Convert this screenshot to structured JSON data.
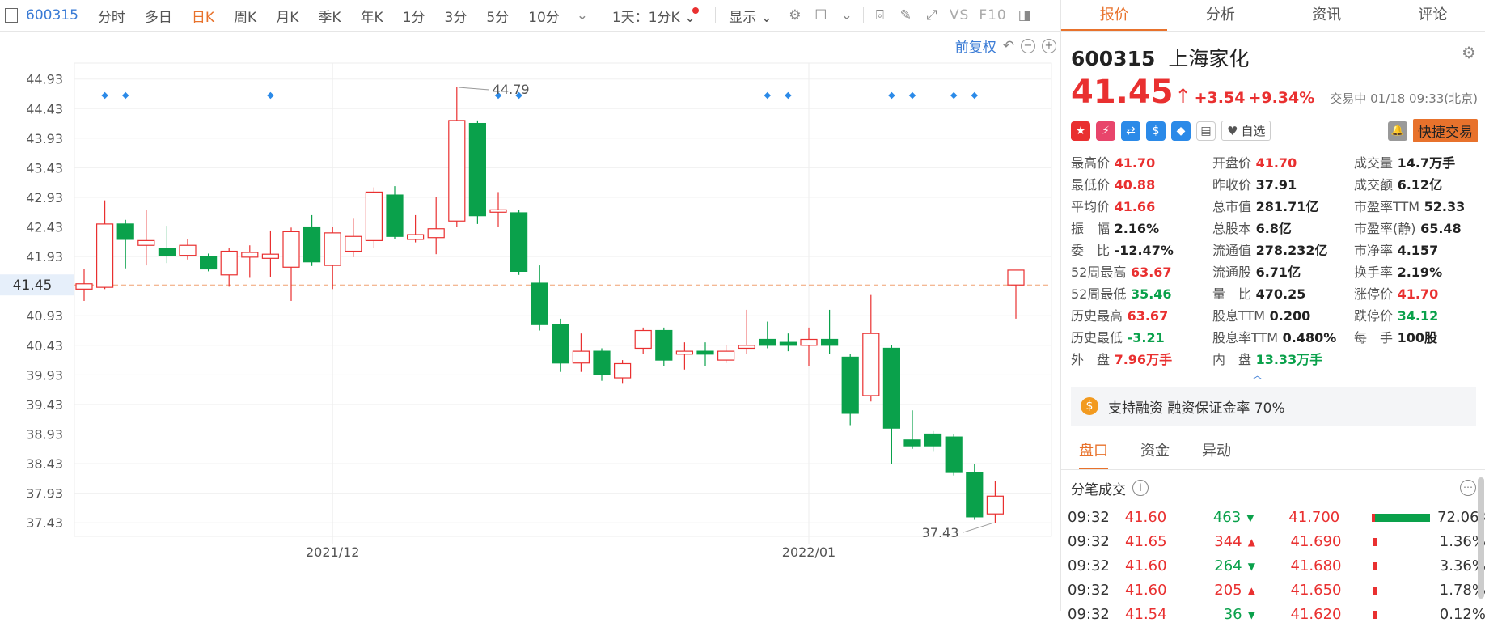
{
  "toolbar": {
    "code": "600315",
    "items": [
      "分时",
      "多日",
      "日K",
      "周K",
      "月K",
      "季K",
      "年K",
      "1分",
      "3分",
      "5分",
      "10分"
    ],
    "active": "日K",
    "period": "1天：1分K",
    "display": "显示",
    "vs": "VS",
    "f10": "F10"
  },
  "chart": {
    "fuquan": "前复权",
    "current_label": "41.45",
    "high_label": "44.79",
    "low_label": "37.43",
    "x_labels": [
      "2021/12",
      "2022/01"
    ]
  },
  "chart_data": {
    "type": "candlestick",
    "y_ticks": [
      "44.93",
      "44.43",
      "43.93",
      "43.43",
      "42.93",
      "42.43",
      "41.93",
      "41.45",
      "40.93",
      "40.43",
      "39.93",
      "39.43",
      "38.93",
      "38.43",
      "37.93",
      "37.43"
    ],
    "ylim": [
      37.2,
      45.2
    ],
    "current_price": 41.45,
    "candles": [
      {
        "o": 41.38,
        "c": 41.47,
        "h": 41.72,
        "l": 41.18
      },
      {
        "o": 41.41,
        "c": 42.48,
        "h": 42.88,
        "l": 41.38
      },
      {
        "o": 42.48,
        "c": 42.22,
        "h": 42.55,
        "l": 41.73
      },
      {
        "o": 42.12,
        "c": 42.2,
        "h": 42.72,
        "l": 41.78
      },
      {
        "o": 42.07,
        "c": 41.95,
        "h": 42.45,
        "l": 41.82
      },
      {
        "o": 41.95,
        "c": 42.12,
        "h": 42.23,
        "l": 41.88
      },
      {
        "o": 41.93,
        "c": 41.72,
        "h": 41.98,
        "l": 41.68
      },
      {
        "o": 41.62,
        "c": 42.02,
        "h": 42.07,
        "l": 41.42
      },
      {
        "o": 41.92,
        "c": 42.0,
        "h": 42.12,
        "l": 41.57
      },
      {
        "o": 41.9,
        "c": 41.97,
        "h": 42.37,
        "l": 41.59
      },
      {
        "o": 41.75,
        "c": 42.35,
        "h": 42.42,
        "l": 41.18
      },
      {
        "o": 42.43,
        "c": 41.84,
        "h": 42.63,
        "l": 41.77
      },
      {
        "o": 41.78,
        "c": 42.33,
        "h": 42.43,
        "l": 41.38
      },
      {
        "o": 42.02,
        "c": 42.27,
        "h": 42.57,
        "l": 41.92
      },
      {
        "o": 42.2,
        "c": 43.02,
        "h": 43.1,
        "l": 42.07
      },
      {
        "o": 42.97,
        "c": 42.27,
        "h": 43.12,
        "l": 42.22
      },
      {
        "o": 42.22,
        "c": 42.3,
        "h": 42.63,
        "l": 42.17
      },
      {
        "o": 42.25,
        "c": 42.4,
        "h": 42.93,
        "l": 41.97
      },
      {
        "o": 42.53,
        "c": 44.23,
        "h": 44.79,
        "l": 42.43
      },
      {
        "o": 44.18,
        "c": 42.62,
        "h": 44.23,
        "l": 42.48
      },
      {
        "o": 42.68,
        "c": 42.72,
        "h": 43.02,
        "l": 42.43
      },
      {
        "o": 42.67,
        "c": 41.68,
        "h": 42.72,
        "l": 41.62
      },
      {
        "o": 41.48,
        "c": 40.78,
        "h": 41.78,
        "l": 40.68
      },
      {
        "o": 40.78,
        "c": 40.13,
        "h": 40.88,
        "l": 39.98
      },
      {
        "o": 40.13,
        "c": 40.33,
        "h": 40.63,
        "l": 39.98
      },
      {
        "o": 40.33,
        "c": 39.93,
        "h": 40.38,
        "l": 39.83
      },
      {
        "o": 39.88,
        "c": 40.12,
        "h": 40.18,
        "l": 39.78
      },
      {
        "o": 40.38,
        "c": 40.68,
        "h": 40.73,
        "l": 40.28
      },
      {
        "o": 40.68,
        "c": 40.18,
        "h": 40.73,
        "l": 40.08
      },
      {
        "o": 40.28,
        "c": 40.33,
        "h": 40.48,
        "l": 40.02
      },
      {
        "o": 40.33,
        "c": 40.28,
        "h": 40.48,
        "l": 40.08
      },
      {
        "o": 40.18,
        "c": 40.33,
        "h": 40.43,
        "l": 40.13
      },
      {
        "o": 40.38,
        "c": 40.43,
        "h": 41.03,
        "l": 40.28
      },
      {
        "o": 40.53,
        "c": 40.43,
        "h": 40.83,
        "l": 40.38
      },
      {
        "o": 40.48,
        "c": 40.43,
        "h": 40.63,
        "l": 40.33
      },
      {
        "o": 40.43,
        "c": 40.53,
        "h": 40.73,
        "l": 40.08
      },
      {
        "o": 40.53,
        "c": 40.43,
        "h": 41.03,
        "l": 40.28
      },
      {
        "o": 40.23,
        "c": 39.28,
        "h": 40.28,
        "l": 39.08
      },
      {
        "o": 39.58,
        "c": 40.63,
        "h": 41.28,
        "l": 39.48
      },
      {
        "o": 40.38,
        "c": 39.03,
        "h": 40.43,
        "l": 38.43
      },
      {
        "o": 38.83,
        "c": 38.73,
        "h": 39.33,
        "l": 38.68
      },
      {
        "o": 38.93,
        "c": 38.73,
        "h": 38.98,
        "l": 38.63
      },
      {
        "o": 38.88,
        "c": 38.28,
        "h": 38.93,
        "l": 38.23
      },
      {
        "o": 38.28,
        "c": 37.53,
        "h": 38.43,
        "l": 37.48
      },
      {
        "o": 37.58,
        "c": 37.88,
        "h": 38.13,
        "l": 37.43
      },
      {
        "o": 41.45,
        "c": 41.7,
        "h": 41.7,
        "l": 40.88
      }
    ],
    "markers_at": [
      1,
      2,
      9,
      20,
      21,
      33,
      34,
      39,
      40,
      42,
      43
    ]
  },
  "panel": {
    "tabs": [
      "报价",
      "分析",
      "资讯",
      "评论"
    ],
    "active_tab": "报价",
    "code": "600315",
    "name": "上海家化",
    "price": "41.45",
    "change": "+3.54",
    "change_pct": "+9.34%",
    "status": "交易中 01/18 09:33(北京)",
    "watch_label": "自选",
    "quick_trade": "快捷交易",
    "quotes": [
      {
        "k": "最高价",
        "v": "41.70",
        "c": "red"
      },
      {
        "k": "开盘价",
        "v": "41.70",
        "c": "red"
      },
      {
        "k": "成交量",
        "v": "14.7万手",
        "c": ""
      },
      {
        "k": "最低价",
        "v": "40.88",
        "c": "red"
      },
      {
        "k": "昨收价",
        "v": "37.91",
        "c": ""
      },
      {
        "k": "成交额",
        "v": "6.12亿",
        "c": ""
      },
      {
        "k": "平均价",
        "v": "41.66",
        "c": "red"
      },
      {
        "k": "总市值",
        "v": "281.71亿",
        "c": ""
      },
      {
        "k": "市盈率TTM",
        "v": "52.33",
        "c": ""
      },
      {
        "k": "振　幅",
        "v": "2.16%",
        "c": ""
      },
      {
        "k": "总股本",
        "v": "6.8亿",
        "c": ""
      },
      {
        "k": "市盈率(静)",
        "v": "65.48",
        "c": ""
      },
      {
        "k": "委　比",
        "v": "-12.47%",
        "c": ""
      },
      {
        "k": "流通值",
        "v": "278.232亿",
        "c": ""
      },
      {
        "k": "市净率",
        "v": "4.157",
        "c": ""
      },
      {
        "k": "52周最高",
        "v": "63.67",
        "c": "red"
      },
      {
        "k": "流通股",
        "v": "6.71亿",
        "c": ""
      },
      {
        "k": "换手率",
        "v": "2.19%",
        "c": ""
      },
      {
        "k": "52周最低",
        "v": "35.46",
        "c": "green"
      },
      {
        "k": "量　比",
        "v": "470.25",
        "c": ""
      },
      {
        "k": "涨停价",
        "v": "41.70",
        "c": "red"
      },
      {
        "k": "历史最高",
        "v": "63.67",
        "c": "red"
      },
      {
        "k": "股息TTM",
        "v": "0.200",
        "c": ""
      },
      {
        "k": "跌停价",
        "v": "34.12",
        "c": "green"
      },
      {
        "k": "历史最低",
        "v": "-3.21",
        "c": "green"
      },
      {
        "k": "股息率TTM",
        "v": "0.480%",
        "c": ""
      },
      {
        "k": "每　手",
        "v": "100股",
        "c": ""
      },
      {
        "k": "外　盘",
        "v": "7.96万手",
        "c": "red"
      },
      {
        "k": "内　盘",
        "v": "13.33万手",
        "c": "green"
      },
      {
        "k": "",
        "v": "",
        "c": ""
      }
    ],
    "margin_text": "支持融资 融资保证金率 70%",
    "subtabs": [
      "盘口",
      "资金",
      "异动"
    ],
    "active_subtab": "盘口",
    "tick_title": "分笔成交",
    "trades": [
      {
        "t": "09:32",
        "p": "41.60",
        "v": "463",
        "d": "down",
        "l": "41.700",
        "pct": "72.06%",
        "fill": 0.72
      },
      {
        "t": "09:32",
        "p": "41.65",
        "v": "344",
        "d": "up",
        "l": "41.690",
        "pct": "1.36%",
        "fill": 0.0
      },
      {
        "t": "09:32",
        "p": "41.60",
        "v": "264",
        "d": "down",
        "l": "41.680",
        "pct": "3.36%",
        "fill": 0.0
      },
      {
        "t": "09:32",
        "p": "41.60",
        "v": "205",
        "d": "up",
        "l": "41.650",
        "pct": "1.78%",
        "fill": 0.0
      },
      {
        "t": "09:32",
        "p": "41.54",
        "v": "36",
        "d": "down",
        "l": "41.620",
        "pct": "0.12%",
        "fill": 0.0
      }
    ]
  }
}
